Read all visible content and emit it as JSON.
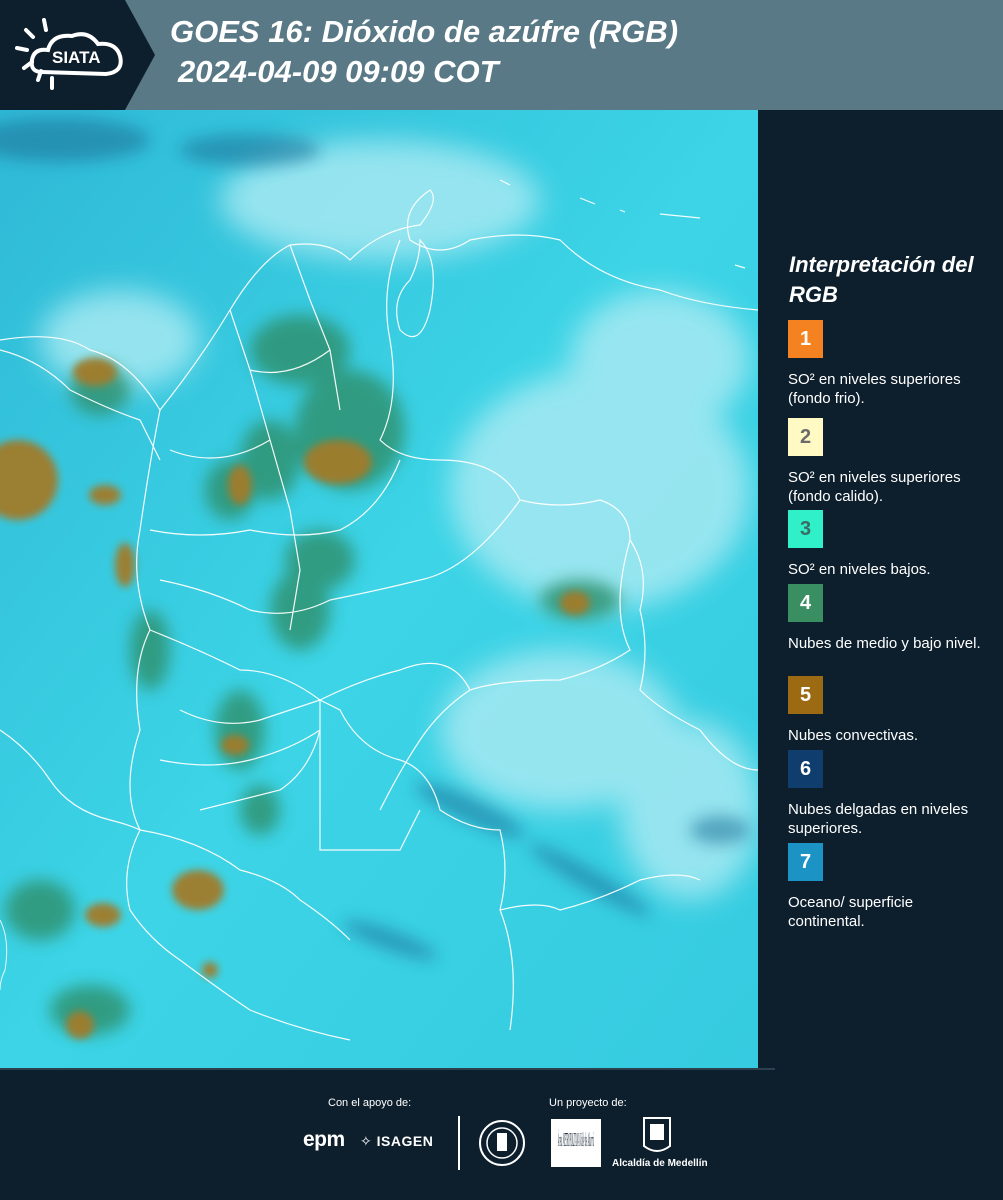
{
  "header": {
    "logo_text": "SIATA",
    "title_line1": "GOES 16: Dióxido de azúfre (RGB)",
    "title_line2": "2024-04-09 09:09 COT"
  },
  "legend": {
    "title": "Interpretación del RGB",
    "items": [
      {
        "number": "1",
        "label": "SO² en niveles superiores (fondo frio).",
        "color": "#f58220",
        "text_color": "#ffffff"
      },
      {
        "number": "2",
        "label": "SO² en niveles superiores (fondo calido).",
        "color": "#fff9c4",
        "text_color": "#6b6b6b"
      },
      {
        "number": "3",
        "label": "SO² en niveles bajos.",
        "color": "#2ff0c8",
        "text_color": "#3a6b64"
      },
      {
        "number": "4",
        "label": "Nubes de medio y bajo nivel.",
        "color": "#3a8f62",
        "text_color": "#ffffff"
      },
      {
        "number": "5",
        "label": "Nubes convectivas.",
        "color": "#9c6a12",
        "text_color": "#ffffff"
      },
      {
        "number": "6",
        "label": "Nubes delgadas en niveles superiores.",
        "color": "#0f3d6e",
        "text_color": "#ffffff"
      },
      {
        "number": "7",
        "label": "Oceano/ superficie continental.",
        "color": "#1b93c4",
        "text_color": "#ffffff"
      }
    ]
  },
  "footer": {
    "support_caption": "Con el apoyo de:",
    "project_caption": "Un proyecto de:",
    "epm": "epm",
    "isagen": "ISAGEN",
    "area_metropolitana": "Área METROPOLITANA Valle de Aburrá",
    "alcaldia": "Alcaldía de Medellín"
  },
  "colors": {
    "header_bg": "#587985",
    "panel_bg": "#0d1f2d",
    "map_cyan": "#3ad6e8"
  }
}
